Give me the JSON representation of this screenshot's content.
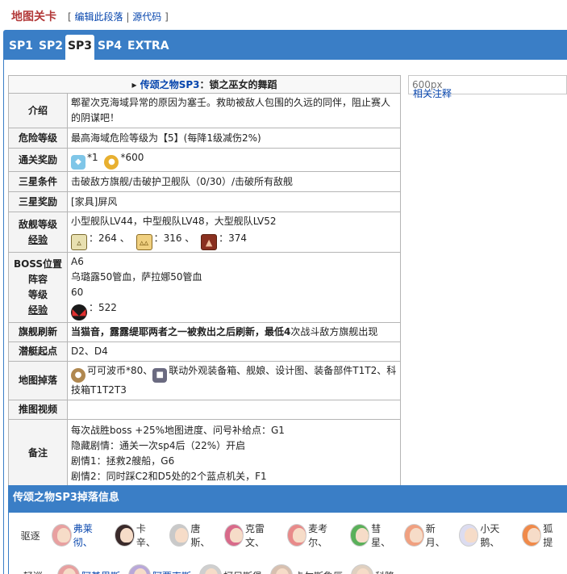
{
  "heading": {
    "title": "地图关卡",
    "edit": "编辑此段落",
    "sep": "|",
    "source": "源代码",
    "open": "[",
    "close": "]"
  },
  "tabs": [
    {
      "label": "SP1"
    },
    {
      "label": "SP2"
    },
    {
      "label": "SP3"
    },
    {
      "label": "SP4"
    },
    {
      "label": "EXTRA"
    }
  ],
  "side": {
    "placeholder": "600px",
    "link": "相关注释"
  },
  "info": {
    "caption_arrow": "▸",
    "caption_link": "传颂之物SP3",
    "caption_rest": "：锁之巫女的舞蹈",
    "intro_label": "介绍",
    "intro": "郫翟次克海域异常的原因为塞壬。救助被敌人包围的久远的同伴，阻止赛人的阴谋吧！",
    "danger_label": "危险等级",
    "danger": "最高海域危险等级为【5】(每降1级减伤2%)",
    "reward_label": "通关奖励",
    "reward_1": "*1",
    "reward_2": "*600",
    "star_cond_label": "三星条件",
    "star_cond": "击破敌方旗舰/击破护卫舰队（0/30）/击破所有敌舰",
    "star_reward_label": "三星奖励",
    "star_reward": "[家具]屏风",
    "enemy_label": "敌舰等级",
    "exp_label": "经验",
    "enemy": "小型舰队LV44，中型舰队LV48，大型舰队LV52",
    "exp_1": "：264 、",
    "exp_2": "：316 、",
    "exp_3": "：374",
    "boss_label_1": "BOSS位置",
    "boss_label_2": "阵容",
    "boss_label_3": "等级",
    "boss_label_4": "经验",
    "boss_pos": "A6",
    "boss_team": "乌璐露50管血，萨拉娜50管血",
    "boss_level": "60",
    "boss_exp": "：522",
    "refresh_label": "旗舰刷新",
    "refresh_bold": "当猫音，露露缇耶两者之一被救出之后刷新，最低4",
    "refresh_rest": "次战斗敌方旗舰出现",
    "sub_label": "潜艇起点",
    "sub": "D2、D4",
    "drop_label": "地图掉落",
    "drop_1": "可可波币*80、",
    "drop_2": "联动外观装备箱、舰娘、设计图、装备部件T1T2、科技箱T1T2T3",
    "video_label": "推图视频",
    "note_label": "备注",
    "notes": [
      "每次战胜boss +25%地图进度、问号补给点：G1",
      "隐藏剧情：通关一次sp4后（22%）开启",
      "剧情1：拯救2艘船，G6",
      "剧情2：同时踩C2和D5处的2个蓝点机关，F1"
    ]
  },
  "drops": {
    "title": "传颂之物SP3掉落信息",
    "destroyer_label": "驱逐",
    "destroyers": [
      {
        "name": "弗莱彻、",
        "link": true,
        "hair": "#e8a0a0"
      },
      {
        "name": "卡辛、",
        "link": false,
        "hair": "#3a2a2a"
      },
      {
        "name": "唐斯、",
        "link": false,
        "hair": "#c9c9c9"
      },
      {
        "name": "克雷文、",
        "link": false,
        "hair": "#d86a8a"
      },
      {
        "name": "麦考尔、",
        "link": false,
        "hair": "#e88a8a"
      },
      {
        "name": "彗星、",
        "link": false,
        "hair": "#5ab05a"
      },
      {
        "name": "新月、",
        "link": false,
        "hair": "#f0a080"
      },
      {
        "name": "小天鹅、",
        "link": false,
        "hair": "#dcdcf0"
      },
      {
        "name": "狐提",
        "link": false,
        "hair": "#f08a4a"
      }
    ],
    "cruiser_label": "轻巡",
    "cruisers": [
      {
        "name": "阿基里斯",
        "link": true,
        "hair": "#e8a0a0"
      },
      {
        "name": "阿贾克斯",
        "link": true,
        "hair": "#b9a8d9"
      },
      {
        "name": "柯尼斯堡",
        "link": false,
        "hair": "#cfcfcf"
      },
      {
        "name": "卡尔斯鲁厄",
        "link": false,
        "hair": "#d8c0b0"
      },
      {
        "name": "科隆",
        "link": false,
        "hair": "#e0d0c0"
      }
    ]
  }
}
